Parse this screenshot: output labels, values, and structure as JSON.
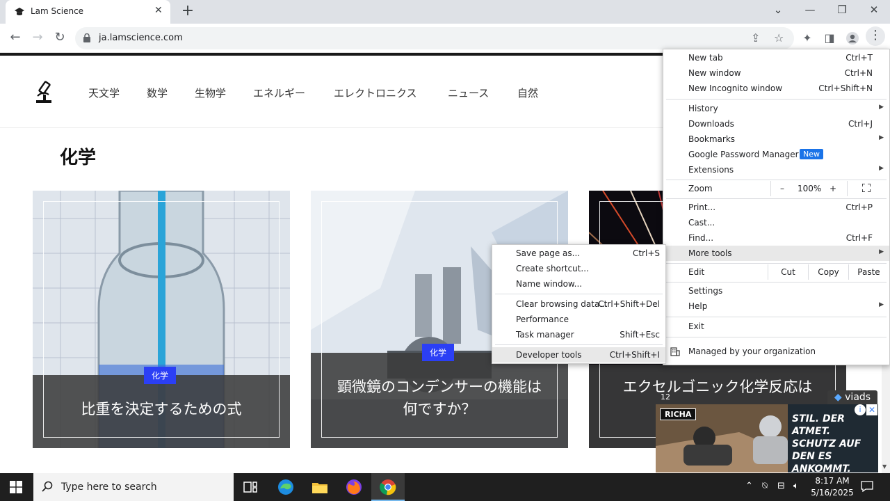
{
  "browser": {
    "tab_title": "Lam Science",
    "url": "ja.lamscience.com"
  },
  "site": {
    "nav": [
      "天文学",
      "数学",
      "生物学",
      "エネルギー",
      "エレクトロニクス",
      "ニュース",
      "自然"
    ],
    "category_title": "化学",
    "cards": [
      {
        "badge": "化学",
        "title": "比重を決定するための式"
      },
      {
        "badge": "化学",
        "title": "顕微鏡のコンデンサーの機能は何ですか？"
      },
      {
        "badge": "",
        "title": "エクセルゴニック化学反応は"
      }
    ]
  },
  "ad": {
    "label": "viads",
    "count": "12",
    "brand": "RICHA",
    "text": "STIL. DER ATMET. SCHUTZ AUF DEN ES ANKOMMT."
  },
  "menu": {
    "new_tab": {
      "label": "New tab",
      "shortcut": "Ctrl+T"
    },
    "new_window": {
      "label": "New window",
      "shortcut": "Ctrl+N"
    },
    "new_incognito": {
      "label": "New Incognito window",
      "shortcut": "Ctrl+Shift+N"
    },
    "history": {
      "label": "History"
    },
    "downloads": {
      "label": "Downloads",
      "shortcut": "Ctrl+J"
    },
    "bookmarks": {
      "label": "Bookmarks"
    },
    "password_manager": {
      "label": "Google Password Manager",
      "badge": "New"
    },
    "extensions": {
      "label": "Extensions"
    },
    "zoom": {
      "label": "Zoom",
      "minus": "–",
      "value": "100%",
      "plus": "+"
    },
    "print": {
      "label": "Print...",
      "shortcut": "Ctrl+P"
    },
    "cast": {
      "label": "Cast..."
    },
    "find": {
      "label": "Find...",
      "shortcut": "Ctrl+F"
    },
    "more_tools": {
      "label": "More tools"
    },
    "edit": {
      "label": "Edit",
      "cut": "Cut",
      "copy": "Copy",
      "paste": "Paste"
    },
    "settings": {
      "label": "Settings"
    },
    "help": {
      "label": "Help"
    },
    "exit": {
      "label": "Exit"
    },
    "managed": {
      "label": "Managed by your organization"
    }
  },
  "submenu": {
    "save_page": {
      "label": "Save page as...",
      "shortcut": "Ctrl+S"
    },
    "create_shortcut": {
      "label": "Create shortcut..."
    },
    "name_window": {
      "label": "Name window..."
    },
    "clear_data": {
      "label": "Clear browsing data...",
      "shortcut": "Ctrl+Shift+Del"
    },
    "performance": {
      "label": "Performance"
    },
    "task_manager": {
      "label": "Task manager",
      "shortcut": "Shift+Esc"
    },
    "dev_tools": {
      "label": "Developer tools",
      "shortcut": "Ctrl+Shift+I"
    }
  },
  "taskbar": {
    "search_placeholder": "Type here to search",
    "time": "8:17 AM",
    "date": "5/16/2025"
  }
}
